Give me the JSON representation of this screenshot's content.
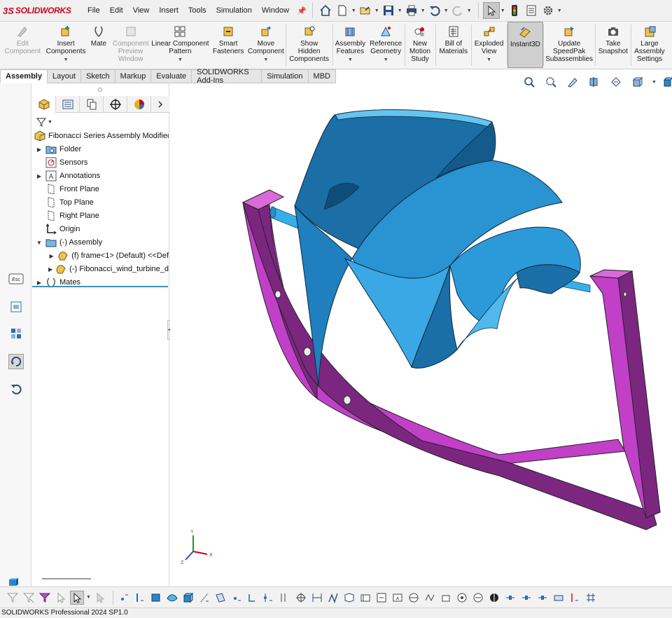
{
  "app": {
    "logo_prefix": "3S",
    "logo_text": "SOLIDWORKS",
    "brand_color": "#d0021b"
  },
  "menu": [
    "File",
    "Edit",
    "View",
    "Insert",
    "Tools",
    "Simulation",
    "Window"
  ],
  "ribbon": [
    {
      "label": "Edit\nComponent",
      "icon": "edit-component-icon",
      "disabled": true
    },
    {
      "label": "Insert\nComponents",
      "icon": "insert-components-icon",
      "dropdown": true
    },
    {
      "label": "Mate",
      "icon": "mate-icon"
    },
    {
      "label": "Component\nPreview\nWindow",
      "icon": "component-preview-icon",
      "disabled": true
    },
    {
      "label": "Linear Component\nPattern",
      "icon": "linear-pattern-icon",
      "dropdown": true
    },
    {
      "label": "Smart\nFasteners",
      "icon": "smart-fasteners-icon"
    },
    {
      "label": "Move\nComponent",
      "icon": "move-component-icon",
      "dropdown": true
    },
    {
      "label": "Show\nHidden\nComponents",
      "icon": "show-hidden-icon"
    },
    {
      "label": "Assembly\nFeatures",
      "icon": "assembly-features-icon",
      "dropdown": true
    },
    {
      "label": "Reference\nGeometry",
      "icon": "reference-geometry-icon",
      "dropdown": true
    },
    {
      "label": "New\nMotion\nStudy",
      "icon": "motion-study-icon"
    },
    {
      "label": "Bill of\nMaterials",
      "icon": "bom-icon"
    },
    {
      "label": "Exploded\nView",
      "icon": "exploded-view-icon",
      "dropdown": true
    },
    {
      "label": "Instant3D",
      "icon": "instant3d-icon",
      "active": true
    },
    {
      "label": "Update\nSpeedPak\nSubassemblies",
      "icon": "speedpak-icon"
    },
    {
      "label": "Take\nSnapshot",
      "icon": "snapshot-icon"
    },
    {
      "label": "Large\nAssembly\nSettings",
      "icon": "large-assembly-icon"
    }
  ],
  "command_tabs": [
    "Assembly",
    "Layout",
    "Sketch",
    "Markup",
    "Evaluate",
    "SOLIDWORKS Add-Ins",
    "Simulation",
    "MBD"
  ],
  "active_tab": "Assembly",
  "tree": {
    "root": "Fibonacci Series Assembly Modified (D",
    "items": [
      {
        "label": "Folder",
        "expand": true
      },
      {
        "label": "Sensors",
        "expand": false
      },
      {
        "label": "Annotations",
        "expand": true
      },
      {
        "label": "Front Plane",
        "expand": false
      },
      {
        "label": "Top Plane",
        "expand": false
      },
      {
        "label": "Right Plane",
        "expand": false
      },
      {
        "label": "Origin",
        "expand": false
      },
      {
        "label": "(-) Assembly",
        "expand": true,
        "open": true
      },
      {
        "label": "(f) frame<1> (Default) <<Def",
        "expand": true,
        "child": true
      },
      {
        "label": "(-) Fibonacci_wind_turbine_d",
        "expand": true,
        "child": true
      },
      {
        "label": "Mates",
        "expand": true
      }
    ]
  },
  "status": "SOLIDWORKS Professional 2024 SP1.0",
  "colors": {
    "blade": "#2aa2e0",
    "blade_dark": "#125f8d",
    "frame": "#c23fc8",
    "frame_dark": "#7b2780"
  },
  "triad": {
    "x": "X",
    "y": "Y",
    "z": "Z"
  }
}
